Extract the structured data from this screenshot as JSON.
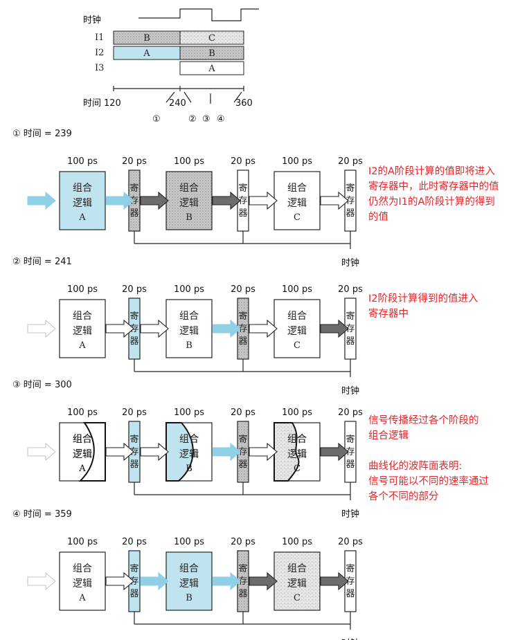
{
  "timing": {
    "clock_label": "时钟",
    "rows": [
      {
        "label": "I1",
        "seg1": "B",
        "seg2": "C"
      },
      {
        "label": "I2",
        "seg1": "A",
        "seg2": "B"
      },
      {
        "label": "I3",
        "seg1": "",
        "seg2": "A"
      }
    ],
    "time_label": "时间",
    "ticks": [
      "120",
      "240",
      "360"
    ],
    "markers": [
      "①",
      "②",
      "③",
      "④"
    ]
  },
  "stages_common": {
    "comb_delay": "100 ps",
    "reg_delay": "20 ps",
    "comb_text_line1": "组合",
    "comb_text_line2": "逻辑",
    "comb_letters": [
      "A",
      "B",
      "C"
    ],
    "reg_chars": [
      "寄",
      "存",
      "器"
    ],
    "clock_label": "时钟"
  },
  "stages": [
    {
      "title": "① 时间 = 239",
      "note": [
        "I2的A阶段计算的值即将进入",
        "寄存器中，此时寄存器中的值",
        "仍然为I1的A阶段计算的得到",
        "的值"
      ]
    },
    {
      "title": "② 时间 = 241",
      "note": [
        "I2阶段计算得到的值进入",
        "寄存器中"
      ]
    },
    {
      "title": "③ 时间 = 300",
      "note": [
        "信号传播经过各个阶段的",
        "组合逻辑",
        "",
        "曲线化的波阵面表明:",
        "信号可能以不同的速率通过",
        "各个不同的部分"
      ]
    },
    {
      "title": "④ 时间 = 359",
      "note": []
    }
  ],
  "colors": {
    "cyan": "#bfe3ef",
    "gray": "#bdbdbd",
    "dark_gray": "#6d6d6d",
    "note_red": "#e3262b"
  }
}
